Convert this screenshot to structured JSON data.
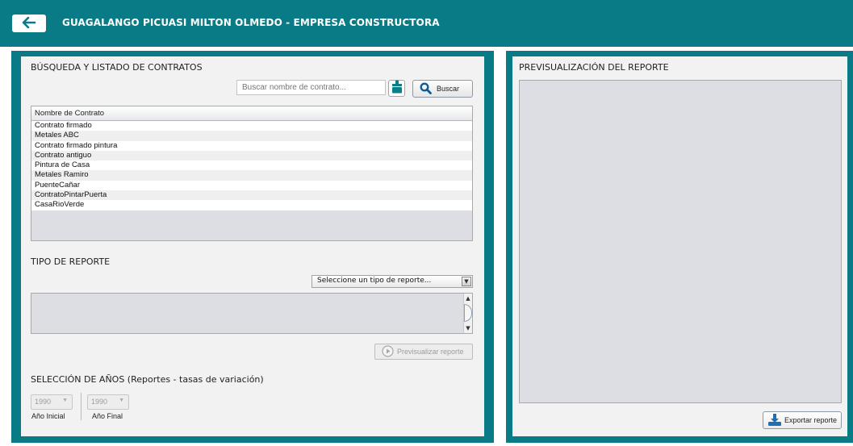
{
  "header": {
    "title": "GUAGALANGO PICUASI MILTON OLMEDO - EMPRESA CONSTRUCTORA",
    "back_icon": "arrow-left-icon",
    "background": "#097b86"
  },
  "contracts": {
    "section_title": "BÚSQUEDA Y LISTADO DE CONTRATOS",
    "search": {
      "placeholder": "Buscar nombre de contrato...",
      "value": ""
    },
    "clear_icon": "brush-icon",
    "search_button": "Buscar",
    "table": {
      "column": "Nombre de Contrato",
      "rows": [
        "Contrato firmado",
        "Metales ABC",
        "Contrato firmado pintura",
        "Contrato antiguo",
        "Pintura de Casa",
        "Metales Ramiro",
        "PuenteCañar",
        "ContratoPintarPuerta",
        "CasaRioVerde"
      ]
    }
  },
  "report_type": {
    "section_title": "TIPO DE REPORTE",
    "select_value": "Seleccione un tipo de reporte...",
    "preview_button": "Previsualizar reporte"
  },
  "years": {
    "section_title": "SELECCIÓN DE AÑOS (Reportes - tasas de variación)",
    "start_value": "1990",
    "start_label": "Año Inicial",
    "end_value": "1990",
    "end_label": "Año Final"
  },
  "preview": {
    "section_title": "PREVISUALIZACIÓN DEL REPORTE",
    "export_button": "Exportar reporte"
  }
}
